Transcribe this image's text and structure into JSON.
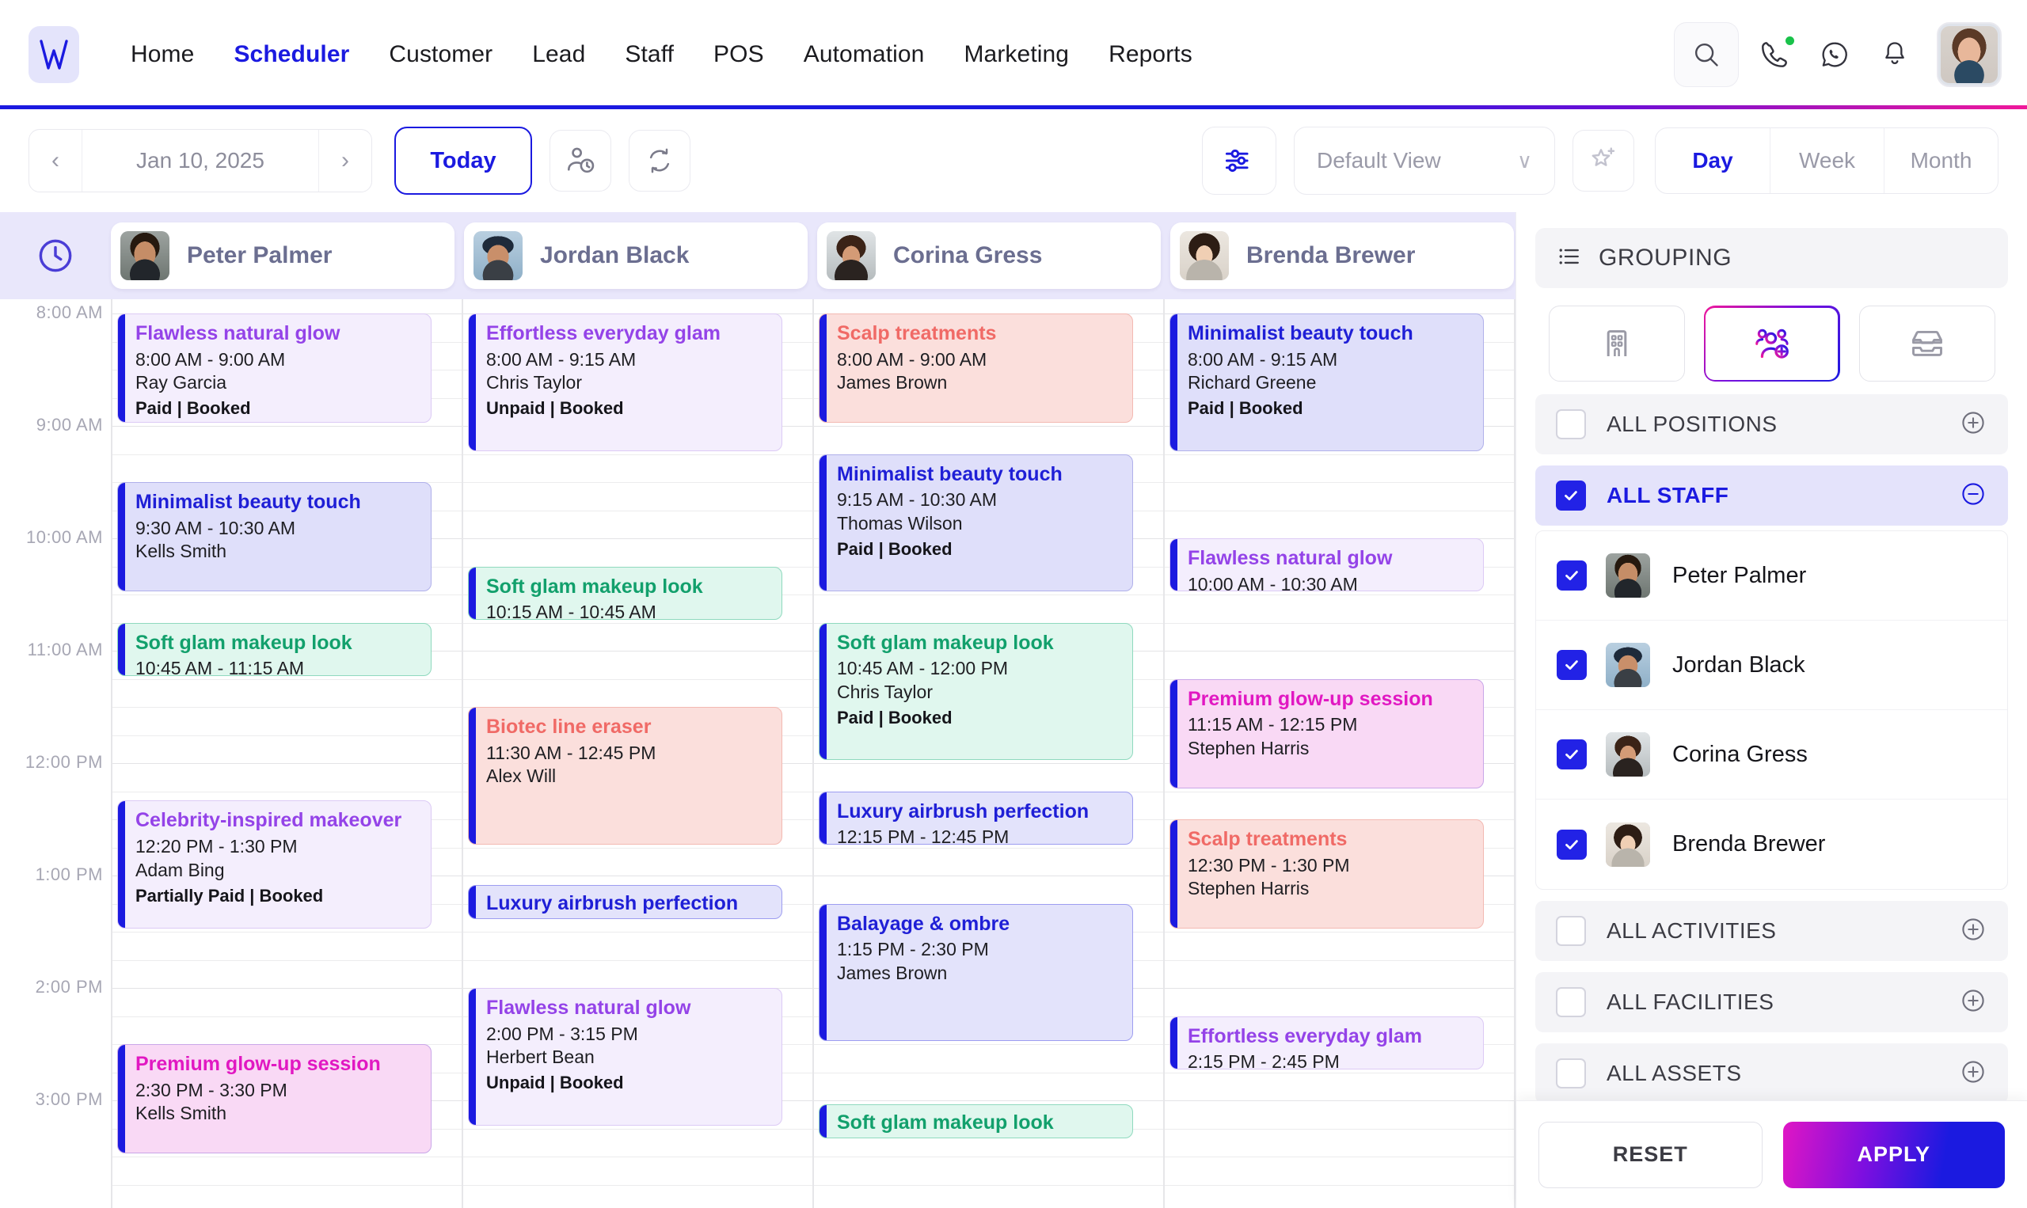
{
  "topnav": {
    "logo": "w-logo",
    "links": [
      {
        "label": "Home",
        "active": false
      },
      {
        "label": "Scheduler",
        "active": true
      },
      {
        "label": "Customer",
        "active": false
      },
      {
        "label": "Lead",
        "active": false
      },
      {
        "label": "Staff",
        "active": false
      },
      {
        "label": "POS",
        "active": false
      },
      {
        "label": "Automation",
        "active": false
      },
      {
        "label": "Marketing",
        "active": false
      },
      {
        "label": "Reports",
        "active": false
      }
    ],
    "icons": [
      "search-icon",
      "phone-call-icon",
      "whatsapp-icon",
      "bell-icon"
    ],
    "accent": "#1b1ae0"
  },
  "toolbar": {
    "prev": "‹",
    "date": "Jan 10, 2025",
    "next": "›",
    "today_label": "Today",
    "waitlist_icon": "person-clock-icon",
    "refresh_icon": "refresh-icon",
    "filter_icon": "sliders-icon",
    "view_select": "Default View",
    "view_chevron": "∨",
    "favorite_icon": "star-plus-icon",
    "modes": [
      {
        "label": "Day",
        "active": true
      },
      {
        "label": "Week",
        "active": false
      },
      {
        "label": "Month",
        "active": false
      }
    ]
  },
  "calendar": {
    "clock_icon": "clock-icon",
    "columns": [
      {
        "name": "Peter Palmer",
        "avatar": "peter-palmer-avatar"
      },
      {
        "name": "Jordan Black",
        "avatar": "jordan-black-avatar"
      },
      {
        "name": "Corina Gress",
        "avatar": "corina-gress-avatar"
      },
      {
        "name": "Brenda Brewer",
        "avatar": "brenda-brewer-avatar"
      }
    ],
    "hours": [
      "8:00 AM",
      "9:00 AM",
      "10:00 AM",
      "11:00 AM",
      "12:00 PM",
      "1:00 PM",
      "2:00 PM",
      "3:00 PM"
    ],
    "events": [
      {
        "col": 0,
        "title": "Flawless natural glow",
        "time": "8:00 AM - 9:00 AM",
        "who": "Ray Garcia",
        "status": "Paid | Booked",
        "palette": "p-purple",
        "start": "8:00",
        "end": "9:00"
      },
      {
        "col": 0,
        "title": "Minimalist beauty touch",
        "time": "9:30 AM - 10:30 AM",
        "who": "Kells Smith",
        "status": "",
        "palette": "p-indigo",
        "start": "9:30",
        "end": "10:30"
      },
      {
        "col": 0,
        "title": "Soft glam makeup look",
        "time": "10:45 AM - 11:15 AM",
        "who": "",
        "status": "",
        "palette": "p-green",
        "start": "10:45",
        "end": "11:15"
      },
      {
        "col": 0,
        "title": "Celebrity-inspired makeover",
        "time": "12:20 PM - 1:30 PM",
        "who": "Adam Bing",
        "status": "Partially Paid | Booked",
        "palette": "p-purple",
        "start": "12:20",
        "end": "13:30"
      },
      {
        "col": 0,
        "title": "Premium glow-up session",
        "time": "2:30 PM - 3:30 PM",
        "who": "Kells Smith",
        "status": "",
        "palette": "p-pink",
        "start": "14:30",
        "end": "15:30"
      },
      {
        "col": 1,
        "title": "Effortless everyday glam",
        "time": "8:00 AM - 9:15 AM",
        "who": "Chris Taylor",
        "status": "Unpaid | Booked",
        "palette": "p-purple",
        "start": "8:00",
        "end": "9:15"
      },
      {
        "col": 1,
        "title": "Soft glam makeup look",
        "time": "10:15 AM - 10:45 AM",
        "who": "",
        "status": "",
        "palette": "p-green",
        "start": "10:15",
        "end": "10:45"
      },
      {
        "col": 1,
        "title": "Biotec line eraser",
        "time": "11:30 AM - 12:45 PM",
        "who": "Alex Will",
        "status": "",
        "palette": "p-red",
        "start": "11:30",
        "end": "12:45"
      },
      {
        "col": 1,
        "title": "Luxury airbrush perfection",
        "time": "",
        "who": "",
        "status": "",
        "palette": "p-indigo2",
        "start": "13:05",
        "end": "13:25"
      },
      {
        "col": 1,
        "title": "Flawless natural glow",
        "time": "2:00 PM - 3:15 PM",
        "who": "Herbert Bean",
        "status": "Unpaid | Booked",
        "palette": "p-purple",
        "start": "14:00",
        "end": "15:15"
      },
      {
        "col": 2,
        "title": "Scalp treatments",
        "time": "8:00 AM - 9:00 AM",
        "who": "James Brown",
        "status": "",
        "palette": "p-red",
        "start": "8:00",
        "end": "9:00"
      },
      {
        "col": 2,
        "title": "Minimalist beauty touch",
        "time": "9:15 AM - 10:30 AM",
        "who": "Thomas Wilson",
        "status": "Paid | Booked",
        "palette": "p-indigo",
        "start": "9:15",
        "end": "10:30"
      },
      {
        "col": 2,
        "title": "Soft glam makeup look",
        "time": "10:45 AM - 12:00 PM",
        "who": "Chris Taylor",
        "status": "Paid | Booked",
        "palette": "p-green",
        "start": "10:45",
        "end": "12:00"
      },
      {
        "col": 2,
        "title": "Luxury airbrush perfection",
        "time": "12:15 PM - 12:45 PM",
        "who": "",
        "status": "",
        "palette": "p-indigo2",
        "start": "12:15",
        "end": "12:45"
      },
      {
        "col": 2,
        "title": "Balayage & ombre",
        "time": "1:15 PM - 2:30 PM",
        "who": "James Brown",
        "status": "",
        "palette": "p-indigo2",
        "start": "13:15",
        "end": "14:30"
      },
      {
        "col": 2,
        "title": "Soft glam makeup look",
        "time": "",
        "who": "",
        "status": "",
        "palette": "p-green",
        "start": "15:02",
        "end": "15:22"
      },
      {
        "col": 3,
        "title": "Minimalist beauty touch",
        "time": "8:00 AM - 9:15 AM",
        "who": "Richard Greene",
        "status": "Paid | Booked",
        "palette": "p-indigo",
        "start": "8:00",
        "end": "9:15"
      },
      {
        "col": 3,
        "title": "Flawless natural glow",
        "time": "10:00 AM - 10:30 AM",
        "who": "",
        "status": "",
        "palette": "p-purple",
        "start": "10:00",
        "end": "10:30"
      },
      {
        "col": 3,
        "title": "Premium glow-up session",
        "time": "11:15 AM - 12:15 PM",
        "who": "Stephen Harris",
        "status": "",
        "palette": "p-pink",
        "start": "11:15",
        "end": "12:15"
      },
      {
        "col": 3,
        "title": "Scalp treatments",
        "time": "12:30 PM - 1:30 PM",
        "who": "Stephen Harris",
        "status": "",
        "palette": "p-red",
        "start": "12:30",
        "end": "13:30"
      },
      {
        "col": 3,
        "title": "Effortless everyday glam",
        "time": "2:15 PM - 2:45 PM",
        "who": "",
        "status": "",
        "palette": "p-purple",
        "start": "14:15",
        "end": "14:45"
      }
    ]
  },
  "panel": {
    "heading": "GROUPING",
    "heading_icon": "list-icon",
    "tiles": [
      {
        "icon": "building-icon",
        "selected": false
      },
      {
        "icon": "people-add-icon",
        "selected": true
      },
      {
        "icon": "tray-icon",
        "selected": false
      }
    ],
    "rows": [
      {
        "label": "ALL POSITIONS",
        "checked": false,
        "toggle": "plus",
        "highlight": false
      },
      {
        "label": "ALL STAFF",
        "checked": true,
        "toggle": "minus",
        "highlight": true
      }
    ],
    "staff": [
      {
        "name": "Peter Palmer",
        "checked": true,
        "avatar": "peter-palmer-avatar"
      },
      {
        "name": "Jordan Black",
        "checked": true,
        "avatar": "jordan-black-avatar"
      },
      {
        "name": "Corina Gress",
        "checked": true,
        "avatar": "corina-gress-avatar"
      },
      {
        "name": "Brenda Brewer",
        "checked": true,
        "avatar": "brenda-brewer-avatar"
      }
    ],
    "rows2": [
      {
        "label": "ALL ACTIVITIES",
        "checked": false,
        "toggle": "plus",
        "highlight": false
      },
      {
        "label": "ALL FACILITIES",
        "checked": false,
        "toggle": "plus",
        "highlight": false
      },
      {
        "label": "ALL ASSETS",
        "checked": false,
        "toggle": "plus",
        "highlight": false
      }
    ],
    "reset_label": "RESET",
    "apply_label": "APPLY"
  }
}
